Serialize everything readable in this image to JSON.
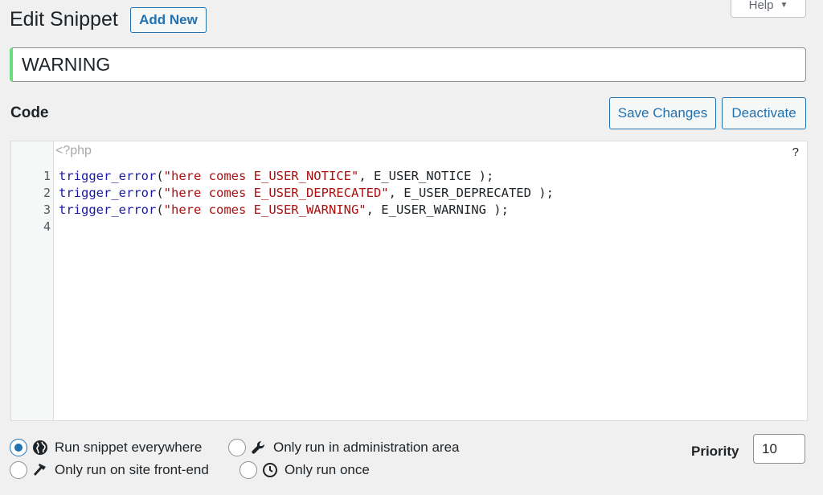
{
  "help": {
    "label": "Help",
    "arrow": "▼"
  },
  "header": {
    "title": "Edit Snippet",
    "add_new": "Add New"
  },
  "snippet": {
    "title": "WARNING"
  },
  "code_section": {
    "heading": "Code",
    "save_label": "Save Changes",
    "deactivate_label": "Deactivate"
  },
  "editor": {
    "php_open": "<?php",
    "help_char": "?",
    "lines": [
      {
        "no": "1",
        "fn": "trigger_error",
        "open": "(",
        "str": "\"here comes E_USER_NOTICE\"",
        "rest": ", E_USER_NOTICE );"
      },
      {
        "no": "2",
        "fn": "trigger_error",
        "open": "(",
        "str": "\"here comes E_USER_DEPRECATED\"",
        "rest": ", E_USER_DEPRECATED );"
      },
      {
        "no": "3",
        "fn": "trigger_error",
        "open": "(",
        "str": "\"here comes E_USER_WARNING\"",
        "rest": ", E_USER_WARNING );"
      },
      {
        "no": "4",
        "fn": "",
        "open": "",
        "str": "",
        "rest": ""
      }
    ]
  },
  "scope_options": [
    {
      "label": "Run snippet everywhere",
      "icon": "globe-icon",
      "checked": true
    },
    {
      "label": "Only run in administration area",
      "icon": "wrench-icon",
      "checked": false
    },
    {
      "label": "Only run on site front-end",
      "icon": "hammer-icon",
      "checked": false
    },
    {
      "label": "Only run once",
      "icon": "clock-icon",
      "checked": false
    }
  ],
  "priority": {
    "label": "Priority",
    "value": "10"
  },
  "colors": {
    "accent": "#2271b1",
    "title_border": "#68de7c",
    "string": "#aa1111",
    "function": "#1a1aa6"
  }
}
